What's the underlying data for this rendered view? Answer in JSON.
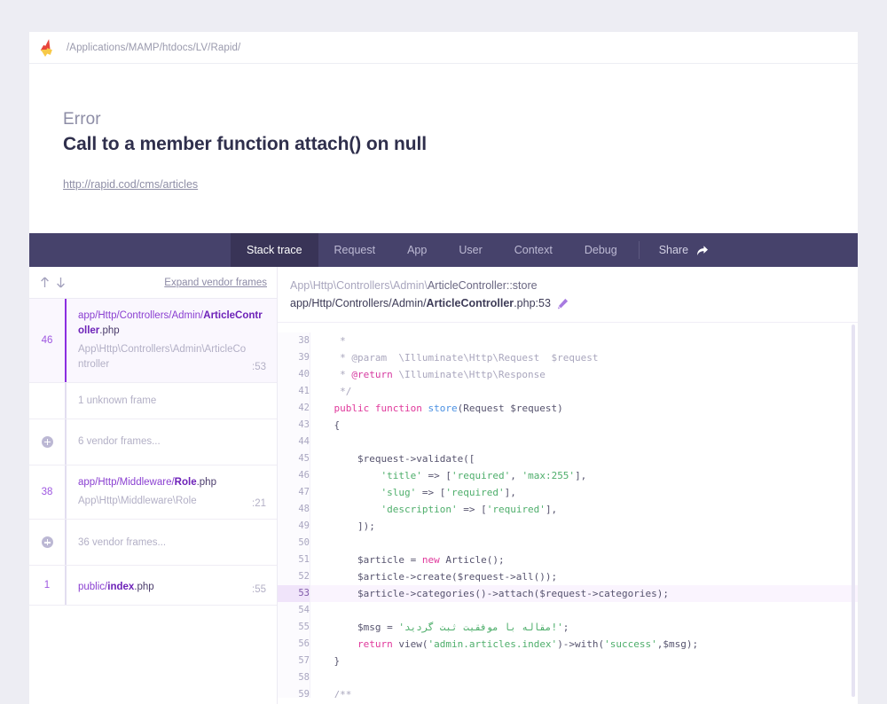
{
  "error_card": {
    "logo_name": "flare-logo",
    "path": "/Applications/MAMP/htdocs/LV/Rapid/",
    "kind": "Error",
    "message": "Call to a member function attach() on null",
    "url": "http://rapid.cod/cms/articles"
  },
  "nav": {
    "tabs": [
      {
        "label": "Stack trace",
        "active": true
      },
      {
        "label": "Request",
        "active": false
      },
      {
        "label": "App",
        "active": false
      },
      {
        "label": "User",
        "active": false
      },
      {
        "label": "Context",
        "active": false
      },
      {
        "label": "Debug",
        "active": false
      }
    ],
    "share_label": "Share"
  },
  "frames_header": {
    "sort_up": "arrow-up-icon",
    "sort_down": "arrow-down-icon",
    "expand_vendor_label": "Expand vendor frames"
  },
  "frames": [
    {
      "type": "frame",
      "selected": true,
      "number": "46",
      "file_prefix": "app/Http/Controllers/Admin/",
      "file_bold": "ArticleController",
      "file_ext": ".php",
      "class": "App\\Http\\Controllers\\Admin\\ArticleController",
      "line": ":53"
    },
    {
      "type": "unknown",
      "label": "1 unknown frame"
    },
    {
      "type": "vendor",
      "label": "6 vendor frames...",
      "icon": "plus-circle-icon"
    },
    {
      "type": "frame",
      "selected": false,
      "number": "38",
      "file_prefix": "app/Http/Middleware/",
      "file_bold": "Role",
      "file_ext": ".php",
      "class": "App\\Http\\Middleware\\Role",
      "line": ":21"
    },
    {
      "type": "vendor",
      "label": "36 vendor frames...",
      "icon": "plus-circle-icon"
    },
    {
      "type": "frame",
      "selected": false,
      "number": "1",
      "file_prefix": "public/",
      "file_bold": "index",
      "file_ext": ".php",
      "class": "",
      "line": ":55"
    }
  ],
  "code_header": {
    "class_path": "App\\Http\\Controllers\\Admin\\",
    "class_name": "ArticleController::store",
    "file_prefix": "app/Http/Controllers/Admin/",
    "file_bold": "ArticleController",
    "file_suffix": ".php:53",
    "edit_icon": "pencil-icon"
  },
  "code_lines": [
    {
      "n": "38",
      "hl": false,
      "tokens": [
        {
          "t": "     * ",
          "c": "tk-com"
        }
      ]
    },
    {
      "n": "39",
      "hl": false,
      "tokens": [
        {
          "t": "     * ",
          "c": "tk-com"
        },
        {
          "t": "@param",
          "c": "tk-com"
        },
        {
          "t": "  \\Illuminate\\Http\\Request  $request",
          "c": "tk-com"
        }
      ]
    },
    {
      "n": "40",
      "hl": false,
      "tokens": [
        {
          "t": "     * ",
          "c": "tk-com"
        },
        {
          "t": "@return",
          "c": "tk-tag"
        },
        {
          "t": " \\Illuminate\\Http\\Response",
          "c": "tk-com"
        }
      ]
    },
    {
      "n": "41",
      "hl": false,
      "tokens": [
        {
          "t": "     */",
          "c": "tk-com"
        }
      ]
    },
    {
      "n": "42",
      "hl": false,
      "tokens": [
        {
          "t": "    ",
          "c": "tk-var"
        },
        {
          "t": "public function ",
          "c": "tk-kw"
        },
        {
          "t": "store",
          "c": "tk-fn"
        },
        {
          "t": "(Request $request)",
          "c": "tk-var"
        }
      ]
    },
    {
      "n": "43",
      "hl": false,
      "tokens": [
        {
          "t": "    {",
          "c": "tk-var"
        }
      ]
    },
    {
      "n": "44",
      "hl": false,
      "tokens": [
        {
          "t": "",
          "c": "tk-var"
        }
      ]
    },
    {
      "n": "45",
      "hl": false,
      "tokens": [
        {
          "t": "        $request->validate([",
          "c": "tk-var"
        }
      ]
    },
    {
      "n": "46",
      "hl": false,
      "tokens": [
        {
          "t": "            ",
          "c": "tk-var"
        },
        {
          "t": "'title'",
          "c": "tk-str"
        },
        {
          "t": " => [",
          "c": "tk-var"
        },
        {
          "t": "'required'",
          "c": "tk-str"
        },
        {
          "t": ", ",
          "c": "tk-var"
        },
        {
          "t": "'max:255'",
          "c": "tk-str"
        },
        {
          "t": "],",
          "c": "tk-var"
        }
      ]
    },
    {
      "n": "47",
      "hl": false,
      "tokens": [
        {
          "t": "            ",
          "c": "tk-var"
        },
        {
          "t": "'slug'",
          "c": "tk-str"
        },
        {
          "t": " => [",
          "c": "tk-var"
        },
        {
          "t": "'required'",
          "c": "tk-str"
        },
        {
          "t": "],",
          "c": "tk-var"
        }
      ]
    },
    {
      "n": "48",
      "hl": false,
      "tokens": [
        {
          "t": "            ",
          "c": "tk-var"
        },
        {
          "t": "'description'",
          "c": "tk-str"
        },
        {
          "t": " => [",
          "c": "tk-var"
        },
        {
          "t": "'required'",
          "c": "tk-str"
        },
        {
          "t": "],",
          "c": "tk-var"
        }
      ]
    },
    {
      "n": "49",
      "hl": false,
      "tokens": [
        {
          "t": "        ]);",
          "c": "tk-var"
        }
      ]
    },
    {
      "n": "50",
      "hl": false,
      "tokens": [
        {
          "t": "",
          "c": "tk-var"
        }
      ]
    },
    {
      "n": "51",
      "hl": false,
      "tokens": [
        {
          "t": "        $article = ",
          "c": "tk-var"
        },
        {
          "t": "new",
          "c": "tk-kw"
        },
        {
          "t": " Article();",
          "c": "tk-var"
        }
      ]
    },
    {
      "n": "52",
      "hl": false,
      "tokens": [
        {
          "t": "        $article->create($request->all());",
          "c": "tk-var"
        }
      ]
    },
    {
      "n": "53",
      "hl": true,
      "tokens": [
        {
          "t": "        $article->categories()->attach($request->categories);",
          "c": "tk-var"
        }
      ]
    },
    {
      "n": "54",
      "hl": false,
      "tokens": [
        {
          "t": "",
          "c": "tk-var"
        }
      ]
    },
    {
      "n": "55",
      "hl": false,
      "tokens": [
        {
          "t": "        $msg = ",
          "c": "tk-var"
        },
        {
          "t": "'مقاله با موفقیت ثبت گردید!'",
          "c": "tk-str"
        },
        {
          "t": ";",
          "c": "tk-var"
        }
      ]
    },
    {
      "n": "56",
      "hl": false,
      "tokens": [
        {
          "t": "        ",
          "c": "tk-var"
        },
        {
          "t": "return",
          "c": "tk-kw"
        },
        {
          "t": " view(",
          "c": "tk-var"
        },
        {
          "t": "'admin.articles.index'",
          "c": "tk-str"
        },
        {
          "t": ")->with(",
          "c": "tk-var"
        },
        {
          "t": "'success'",
          "c": "tk-str"
        },
        {
          "t": ",$msg);",
          "c": "tk-var"
        }
      ]
    },
    {
      "n": "57",
      "hl": false,
      "tokens": [
        {
          "t": "    }",
          "c": "tk-var"
        }
      ]
    },
    {
      "n": "58",
      "hl": false,
      "tokens": [
        {
          "t": "",
          "c": "tk-var"
        }
      ]
    },
    {
      "n": "59",
      "hl": false,
      "tokens": [
        {
          "t": "    /**",
          "c": "tk-com"
        }
      ]
    }
  ],
  "colors": {
    "page_bg": "#ededf3",
    "nav_bg": "#46426b",
    "nav_active_bg": "#393457",
    "accent_purple": "#8b2fe0",
    "highlight_row": "#faf4fe",
    "string_green": "#4eae6b",
    "keyword_pink": "#e0389b"
  }
}
